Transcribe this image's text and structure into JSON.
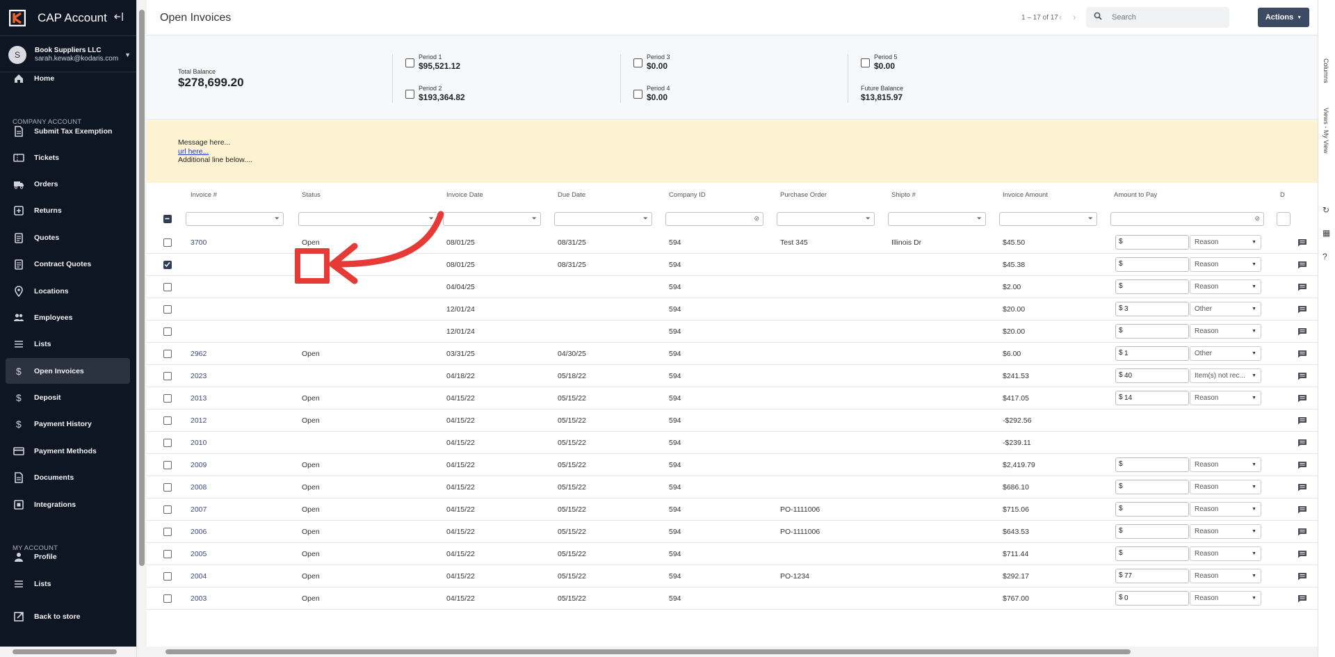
{
  "app": {
    "title": "CAP Account"
  },
  "user": {
    "initial": "S",
    "company": "Book Suppliers LLC",
    "email": "sarah.kewak@kodaris.com"
  },
  "sidebar": {
    "section_company": "COMPANY ACCOUNT",
    "section_my": "MY ACCOUNT",
    "items": [
      {
        "label": "Home",
        "icon": "home-icon"
      },
      {
        "label": "Submit Tax Exemption",
        "icon": "document-icon"
      },
      {
        "label": "Tickets",
        "icon": "ticket-icon"
      },
      {
        "label": "Orders",
        "icon": "truck-icon"
      },
      {
        "label": "Returns",
        "icon": "return-icon"
      },
      {
        "label": "Quotes",
        "icon": "clipboard-icon"
      },
      {
        "label": "Contract Quotes",
        "icon": "clipboard-icon"
      },
      {
        "label": "Locations",
        "icon": "location-pin-icon"
      },
      {
        "label": "Employees",
        "icon": "people-icon"
      },
      {
        "label": "Lists",
        "icon": "list-icon"
      },
      {
        "label": "Open Invoices",
        "icon": "dollar-icon"
      },
      {
        "label": "Deposit",
        "icon": "dollar-icon"
      },
      {
        "label": "Payment History",
        "icon": "dollar-icon"
      },
      {
        "label": "Payment Methods",
        "icon": "credit-card-icon"
      },
      {
        "label": "Documents",
        "icon": "document-icon"
      },
      {
        "label": "Integrations",
        "icon": "integration-icon"
      },
      {
        "label": "Profile",
        "icon": "person-icon"
      },
      {
        "label": "Lists",
        "icon": "list-icon"
      },
      {
        "label": "Back to store",
        "icon": "external-link-icon"
      }
    ]
  },
  "header": {
    "title": "Open Invoices",
    "pager": "1 – 17 of 17",
    "search_placeholder": "Search",
    "actions_label": "Actions"
  },
  "summary": {
    "total_label": "Total Balance",
    "total_value": "$278,699.20",
    "p1_label": "Period 1",
    "p1_value": "$95,521.12",
    "p2_label": "Period 2",
    "p2_value": "$193,364.82",
    "p3_label": "Period 3",
    "p3_value": "$0.00",
    "p4_label": "Period 4",
    "p4_value": "$0.00",
    "p5_label": "Period 5",
    "p5_value": "$0.00",
    "future_label": "Future Balance",
    "future_value": "$13,815.97"
  },
  "message": {
    "line1": "Message here...",
    "line2": "url here...",
    "line3": "Additional line below...."
  },
  "right_rail": {
    "columns": "Columns",
    "views": "Views - My View"
  },
  "columns": [
    "Invoice #",
    "Status",
    "Invoice Date",
    "Due Date",
    "Company ID",
    "Purchase Order",
    "Shipto #",
    "Invoice Amount",
    "Amount to Pay",
    "D"
  ],
  "rows": [
    {
      "invoice": "3700",
      "status": "Open",
      "inv_date": "08/01/25",
      "due": "08/31/25",
      "company": "594",
      "po": "Test 345",
      "shipto": "Illinois Dr",
      "amount": "$45.50",
      "pay": "",
      "reason": "Reason",
      "checked": false,
      "editable": true
    },
    {
      "invoice": "",
      "status": "",
      "inv_date": "08/01/25",
      "due": "08/31/25",
      "company": "594",
      "po": "",
      "shipto": "",
      "amount": "$45.38",
      "pay": "",
      "reason": "Reason",
      "checked": true,
      "editable": true
    },
    {
      "invoice": "",
      "status": "",
      "inv_date": "04/04/25",
      "due": "",
      "company": "594",
      "po": "",
      "shipto": "",
      "amount": "$2.00",
      "pay": "",
      "reason": "Reason",
      "checked": false,
      "editable": true
    },
    {
      "invoice": "",
      "status": "",
      "inv_date": "12/01/24",
      "due": "",
      "company": "594",
      "po": "",
      "shipto": "",
      "amount": "$20.00",
      "pay": "3",
      "reason": "Other",
      "checked": false,
      "editable": true
    },
    {
      "invoice": "",
      "status": "",
      "inv_date": "12/01/24",
      "due": "",
      "company": "594",
      "po": "",
      "shipto": "",
      "amount": "$20.00",
      "pay": "",
      "reason": "Reason",
      "checked": false,
      "editable": true
    },
    {
      "invoice": "2962",
      "status": "Open",
      "inv_date": "03/31/25",
      "due": "04/30/25",
      "company": "594",
      "po": "",
      "shipto": "",
      "amount": "$6.00",
      "pay": "1",
      "reason": "Other",
      "checked": false,
      "editable": true
    },
    {
      "invoice": "2023",
      "status": "",
      "inv_date": "04/18/22",
      "due": "05/18/22",
      "company": "594",
      "po": "",
      "shipto": "",
      "amount": "$241.53",
      "pay": "40",
      "reason": "Item(s) not rec...",
      "checked": false,
      "editable": true
    },
    {
      "invoice": "2013",
      "status": "Open",
      "inv_date": "04/15/22",
      "due": "05/15/22",
      "company": "594",
      "po": "",
      "shipto": "",
      "amount": "$417.05",
      "pay": "14",
      "reason": "Reason",
      "checked": false,
      "editable": true
    },
    {
      "invoice": "2012",
      "status": "Open",
      "inv_date": "04/15/22",
      "due": "05/15/22",
      "company": "594",
      "po": "",
      "shipto": "",
      "amount": "-$292.56",
      "pay": "",
      "reason": "",
      "checked": false,
      "editable": false
    },
    {
      "invoice": "2010",
      "status": "",
      "inv_date": "04/15/22",
      "due": "05/15/22",
      "company": "594",
      "po": "",
      "shipto": "",
      "amount": "-$239.11",
      "pay": "",
      "reason": "",
      "checked": false,
      "editable": false
    },
    {
      "invoice": "2009",
      "status": "Open",
      "inv_date": "04/15/22",
      "due": "05/15/22",
      "company": "594",
      "po": "",
      "shipto": "",
      "amount": "$2,419.79",
      "pay": "",
      "reason": "Reason",
      "checked": false,
      "editable": true
    },
    {
      "invoice": "2008",
      "status": "Open",
      "inv_date": "04/15/22",
      "due": "05/15/22",
      "company": "594",
      "po": "",
      "shipto": "",
      "amount": "$686.10",
      "pay": "",
      "reason": "Reason",
      "checked": false,
      "editable": true
    },
    {
      "invoice": "2007",
      "status": "Open",
      "inv_date": "04/15/22",
      "due": "05/15/22",
      "company": "594",
      "po": "PO-1111006",
      "shipto": "",
      "amount": "$715.06",
      "pay": "",
      "reason": "Reason",
      "checked": false,
      "editable": true
    },
    {
      "invoice": "2006",
      "status": "Open",
      "inv_date": "04/15/22",
      "due": "05/15/22",
      "company": "594",
      "po": "PO-1111006",
      "shipto": "",
      "amount": "$643.53",
      "pay": "",
      "reason": "Reason",
      "checked": false,
      "editable": true
    },
    {
      "invoice": "2005",
      "status": "Open",
      "inv_date": "04/15/22",
      "due": "05/15/22",
      "company": "594",
      "po": "",
      "shipto": "",
      "amount": "$711.44",
      "pay": "",
      "reason": "Reason",
      "checked": false,
      "editable": true
    },
    {
      "invoice": "2004",
      "status": "Open",
      "inv_date": "04/15/22",
      "due": "05/15/22",
      "company": "594",
      "po": "PO-1234",
      "shipto": "",
      "amount": "$292.17",
      "pay": "77",
      "reason": "Reason",
      "checked": false,
      "editable": true
    },
    {
      "invoice": "2003",
      "status": "Open",
      "inv_date": "04/15/22",
      "due": "05/15/22",
      "company": "594",
      "po": "",
      "shipto": "",
      "amount": "$767.00",
      "pay": "0",
      "reason": "Reason",
      "checked": false,
      "editable": true
    }
  ],
  "colors": {
    "sidebar_bg": "#0f1623",
    "accent": "#3c4a63",
    "logo_orange": "#e8622c",
    "callout_red": "#e53a35",
    "message_bg": "#fdf3d3"
  }
}
